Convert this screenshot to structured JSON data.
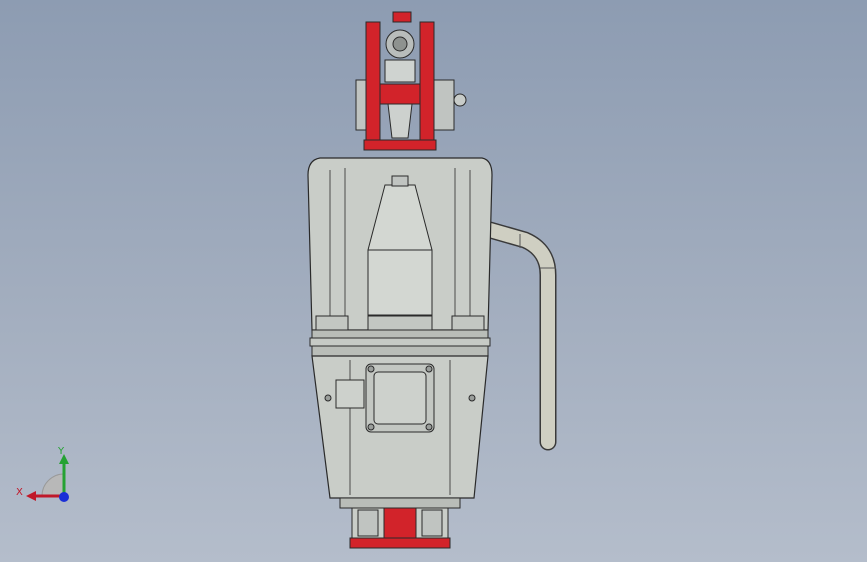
{
  "viewport": {
    "background_top": "#8d9cb2",
    "background_bottom": "#b4bdcb"
  },
  "model": {
    "body_color": "#c9cdc8",
    "accent_color": "#d2232a",
    "hose_color": "#cfcfc2",
    "outline_color": "#2a2a2a"
  },
  "triad": {
    "x_label": "X",
    "y_label": "Y",
    "x_color": "#c0192a",
    "y_color": "#25a233",
    "z_color": "#1a2fd6"
  }
}
